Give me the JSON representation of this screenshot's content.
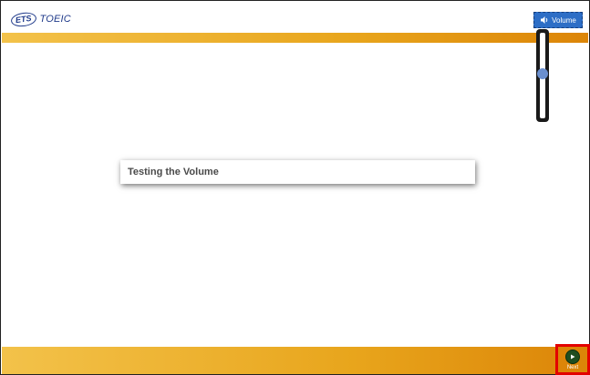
{
  "header": {
    "logo_ets": "ETS",
    "logo_toeic": "TOEIC"
  },
  "volume": {
    "button_label": "Volume",
    "level": 0.52
  },
  "main": {
    "card_title": "Testing the Volume"
  },
  "footer": {
    "next_label": "Next"
  },
  "colors": {
    "brand_blue": "#1f3a8a",
    "gold_light": "#f3c24a",
    "gold_dark": "#dc8508",
    "volume_button": "#2d6ec6",
    "highlight_red": "#e30000",
    "next_green": "#1f4d20"
  },
  "icons": {
    "volume": "speaker-icon",
    "next": "play-icon"
  }
}
